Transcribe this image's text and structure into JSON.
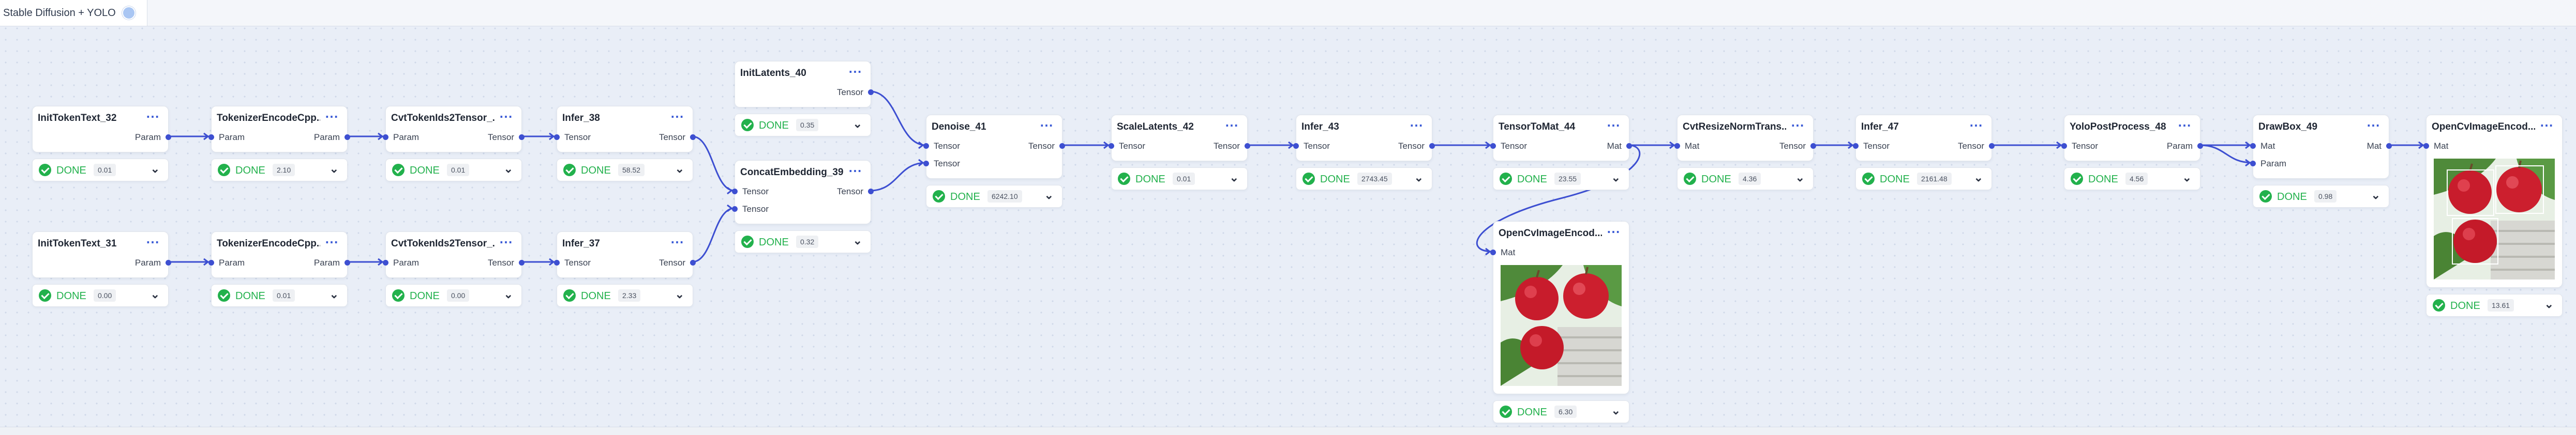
{
  "app": {
    "tab_title": "Stable Diffusion + YOLO"
  },
  "nodes": [
    {
      "id": "InitTokenText_32",
      "title": "InitTokenText_32",
      "inputs": [],
      "outputs": [
        "Param"
      ],
      "status": "DONE",
      "time": "0.01"
    },
    {
      "id": "TokenizerEncodeCpp_a",
      "title": "TokenizerEncodeCpp...",
      "inputs": [
        "Param"
      ],
      "outputs": [
        "Param"
      ],
      "status": "DONE",
      "time": "2.10"
    },
    {
      "id": "CvtTokenIds2Tensor_a",
      "title": "CvtTokenIds2Tensor_...",
      "inputs": [
        "Param"
      ],
      "outputs": [
        "Tensor"
      ],
      "status": "DONE",
      "time": "0.01"
    },
    {
      "id": "Infer_38",
      "title": "Infer_38",
      "inputs": [
        "Tensor"
      ],
      "outputs": [
        "Tensor"
      ],
      "status": "DONE",
      "time": "58.52"
    },
    {
      "id": "InitTokenText_31",
      "title": "InitTokenText_31",
      "inputs": [],
      "outputs": [
        "Param"
      ],
      "status": "DONE",
      "time": "0.00"
    },
    {
      "id": "TokenizerEncodeCpp_b",
      "title": "TokenizerEncodeCpp...",
      "inputs": [
        "Param"
      ],
      "outputs": [
        "Param"
      ],
      "status": "DONE",
      "time": "0.01"
    },
    {
      "id": "CvtTokenIds2Tensor_b",
      "title": "CvtTokenIds2Tensor_...",
      "inputs": [
        "Param"
      ],
      "outputs": [
        "Tensor"
      ],
      "status": "DONE",
      "time": "0.00"
    },
    {
      "id": "Infer_37",
      "title": "Infer_37",
      "inputs": [
        "Tensor"
      ],
      "outputs": [
        "Tensor"
      ],
      "status": "DONE",
      "time": "2.33"
    },
    {
      "id": "InitLatents_40",
      "title": "InitLatents_40",
      "inputs": [],
      "outputs": [
        "Tensor"
      ],
      "status": "DONE",
      "time": "0.35"
    },
    {
      "id": "ConcatEmbedding_39",
      "title": "ConcatEmbedding_39",
      "inputs": [
        "Tensor",
        "Tensor"
      ],
      "outputs": [
        "Tensor"
      ],
      "status": "DONE",
      "time": "0.32"
    },
    {
      "id": "Denoise_41",
      "title": "Denoise_41",
      "inputs": [
        "Tensor",
        "Tensor"
      ],
      "outputs": [
        "Tensor"
      ],
      "status": "DONE",
      "time": "6242.10"
    },
    {
      "id": "ScaleLatents_42",
      "title": "ScaleLatents_42",
      "inputs": [
        "Tensor"
      ],
      "outputs": [
        "Tensor"
      ],
      "status": "DONE",
      "time": "0.01"
    },
    {
      "id": "Infer_43",
      "title": "Infer_43",
      "inputs": [
        "Tensor"
      ],
      "outputs": [
        "Tensor"
      ],
      "status": "DONE",
      "time": "2743.45"
    },
    {
      "id": "TensorToMat_44",
      "title": "TensorToMat_44",
      "inputs": [
        "Tensor"
      ],
      "outputs": [
        "Mat"
      ],
      "status": "DONE",
      "time": "23.55"
    },
    {
      "id": "OpenCvImageEncod_mid",
      "title": "OpenCvImageEncod...",
      "inputs": [
        "Mat"
      ],
      "outputs": [],
      "status": "DONE",
      "time": "6.30",
      "preview": "apples-image"
    },
    {
      "id": "CvtResizeNormTrans",
      "title": "CvtResizeNormTrans...",
      "inputs": [
        "Mat"
      ],
      "outputs": [
        "Tensor"
      ],
      "status": "DONE",
      "time": "4.36"
    },
    {
      "id": "Infer_47",
      "title": "Infer_47",
      "inputs": [
        "Tensor"
      ],
      "outputs": [
        "Tensor"
      ],
      "status": "DONE",
      "time": "2161.48"
    },
    {
      "id": "YoloPostProcess_48",
      "title": "YoloPostProcess_48",
      "inputs": [
        "Tensor"
      ],
      "outputs": [
        "Param"
      ],
      "status": "DONE",
      "time": "4.56"
    },
    {
      "id": "DrawBox_49",
      "title": "DrawBox_49",
      "inputs": [
        "Mat",
        "Param"
      ],
      "outputs": [
        "Mat"
      ],
      "status": "DONE",
      "time": "0.98"
    },
    {
      "id": "OpenCvImageEncod_end",
      "title": "OpenCvImageEncod...",
      "inputs": [
        "Mat"
      ],
      "outputs": [],
      "status": "DONE",
      "time": "13.61",
      "preview": "apples-image-with-boxes"
    }
  ],
  "edges": [
    [
      "InitTokenText_32",
      0,
      "TokenizerEncodeCpp_a",
      0
    ],
    [
      "TokenizerEncodeCpp_a",
      0,
      "CvtTokenIds2Tensor_a",
      0
    ],
    [
      "CvtTokenIds2Tensor_a",
      0,
      "Infer_38",
      0
    ],
    [
      "InitTokenText_31",
      0,
      "TokenizerEncodeCpp_b",
      0
    ],
    [
      "TokenizerEncodeCpp_b",
      0,
      "CvtTokenIds2Tensor_b",
      0
    ],
    [
      "CvtTokenIds2Tensor_b",
      0,
      "Infer_37",
      0
    ],
    [
      "Infer_38",
      0,
      "ConcatEmbedding_39",
      0
    ],
    [
      "Infer_37",
      0,
      "ConcatEmbedding_39",
      1
    ],
    [
      "InitLatents_40",
      0,
      "Denoise_41",
      0
    ],
    [
      "ConcatEmbedding_39",
      0,
      "Denoise_41",
      1
    ],
    [
      "Denoise_41",
      0,
      "ScaleLatents_42",
      0
    ],
    [
      "ScaleLatents_42",
      0,
      "Infer_43",
      0
    ],
    [
      "Infer_43",
      0,
      "TensorToMat_44",
      0
    ],
    [
      "TensorToMat_44",
      0,
      "CvtResizeNormTrans",
      0
    ],
    [
      "TensorToMat_44",
      0,
      "OpenCvImageEncod_mid",
      0
    ],
    [
      "CvtResizeNormTrans",
      0,
      "Infer_47",
      0
    ],
    [
      "Infer_47",
      0,
      "YoloPostProcess_48",
      0
    ],
    [
      "YoloPostProcess_48",
      0,
      "DrawBox_49",
      0
    ],
    [
      "YoloPostProcess_48",
      0,
      "DrawBox_49",
      1
    ],
    [
      "DrawBox_49",
      0,
      "OpenCvImageEncod_end",
      0
    ]
  ],
  "colors": {
    "edge": "#3d4fd1",
    "done": "#22b14c",
    "menu": "#3b5bd6",
    "canvas": "#e9eef7"
  },
  "icons": {
    "node_menu": "more-dots-icon",
    "status_done": "check-circle-icon",
    "status_expand": "chevron-down-icon"
  }
}
